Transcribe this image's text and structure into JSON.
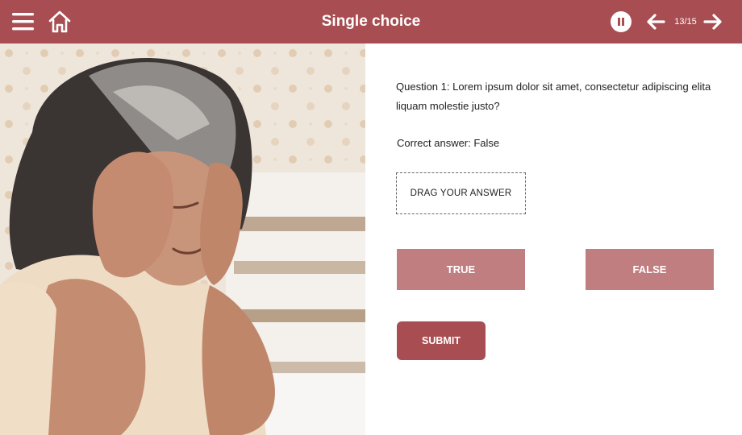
{
  "colors": {
    "primary": "#a84e52",
    "choice": "#c07e80",
    "header_text": "#ffffff"
  },
  "header": {
    "title": "Single choice",
    "counter": "13/15",
    "icons": [
      "menu-icon",
      "home-icon",
      "pause-icon",
      "arrow-left-icon",
      "arrow-right-icon"
    ]
  },
  "content": {
    "question": "Question 1: Lorem ipsum dolor sit amet, consectetur adipiscing elita liquam molestie justo?",
    "correct_answer": "Correct answer: False",
    "drop_zone_label": "DRAG YOUR ANSWER",
    "options": [
      "TRUE",
      "FALSE"
    ],
    "submit_label": "SUBMIT"
  }
}
